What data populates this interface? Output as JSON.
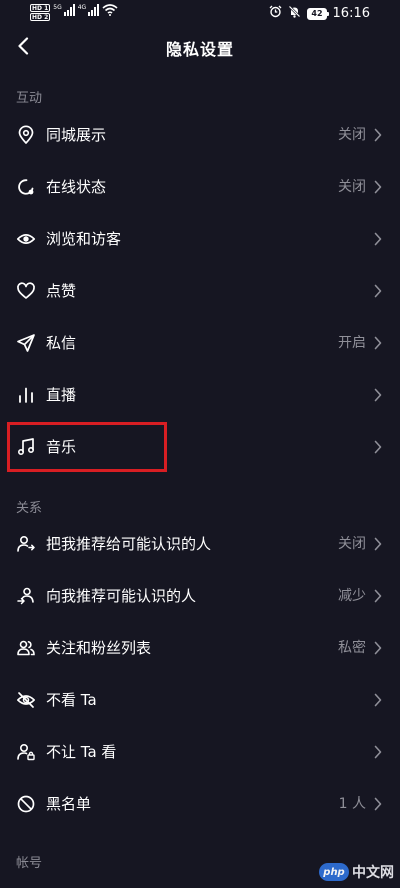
{
  "status_bar": {
    "hd_1": "HD 1",
    "hd_2": "HD 2",
    "signal_1_tag": "5G",
    "signal_2_tag": "4G",
    "battery": "42",
    "time": "16:16"
  },
  "header": {
    "title": "隐私设置",
    "back_icon": "chevron-left-icon"
  },
  "sections": [
    {
      "label": "互动",
      "items": [
        {
          "label": "同城展示",
          "value": "关闭",
          "icon": "location-pin-icon"
        },
        {
          "label": "在线状态",
          "value": "关闭",
          "icon": "online-status-icon"
        },
        {
          "label": "浏览和访客",
          "value": "",
          "icon": "eye-icon"
        },
        {
          "label": "点赞",
          "value": "",
          "icon": "heart-icon"
        },
        {
          "label": "私信",
          "value": "开启",
          "icon": "send-icon"
        },
        {
          "label": "直播",
          "value": "",
          "icon": "live-bars-icon"
        },
        {
          "label": "音乐",
          "value": "",
          "icon": "music-note-icon",
          "highlighted": true
        }
      ]
    },
    {
      "label": "关系",
      "items": [
        {
          "label": "把我推荐给可能认识的人",
          "value": "关闭",
          "icon": "recommend-me-icon"
        },
        {
          "label": "向我推荐可能认识的人",
          "value": "减少",
          "icon": "recommend-to-me-icon"
        },
        {
          "label": "关注和粉丝列表",
          "value": "私密",
          "icon": "followers-icon"
        },
        {
          "label": "不看 Ta",
          "value": "",
          "icon": "eye-off-icon"
        },
        {
          "label": "不让 Ta 看",
          "value": "",
          "icon": "user-lock-icon"
        },
        {
          "label": "黑名单",
          "value": "1 人",
          "icon": "block-icon"
        }
      ]
    },
    {
      "label": "帐号",
      "items": []
    }
  ],
  "watermark": {
    "badge": "php",
    "text": "中文网"
  },
  "colors": {
    "background": "#161622",
    "secondary_text": "#8f8f98",
    "highlight_border": "#d81e23"
  }
}
